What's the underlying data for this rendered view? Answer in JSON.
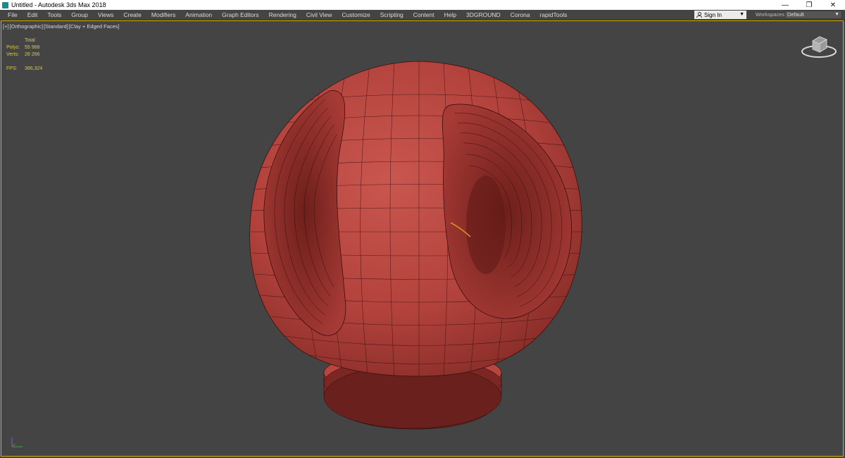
{
  "window": {
    "title": "Untitled - Autodesk 3ds Max 2018",
    "controls": {
      "minimize": "—",
      "restore": "❐",
      "close": "✕"
    }
  },
  "menubar": {
    "items": [
      "File",
      "Edit",
      "Tools",
      "Group",
      "Views",
      "Create",
      "Modifiers",
      "Animation",
      "Graph Editors",
      "Rendering",
      "Civil View",
      "Customize",
      "Scripting",
      "Content",
      "Help",
      "3DGROUND",
      "Corona",
      "rapidTools"
    ],
    "sign_in": "Sign In",
    "workspaces_label": "Workspaces:",
    "workspaces_value": "Default"
  },
  "viewport": {
    "label_parts": [
      "[+]",
      "[Orthographic]",
      "[Standard]",
      "[Clay + Edged Faces]"
    ],
    "stats": {
      "header": "Total",
      "polys_label": "Polys:",
      "polys_value": "55 968",
      "verts_label": "Verts:",
      "verts_value": "28 266",
      "fps_label": "FPS:",
      "fps_value": "386,324"
    }
  },
  "colors": {
    "viewport_bg": "#444444",
    "active_border": "#d4b200",
    "clay": "#b8443f",
    "clay_dark": "#7a2622",
    "wire": "#2a0a08",
    "stats_text": "#d8c840"
  },
  "icons": {
    "viewcube": "viewcube-icon",
    "axis": "axis-tripod-icon",
    "user": "user-icon"
  }
}
